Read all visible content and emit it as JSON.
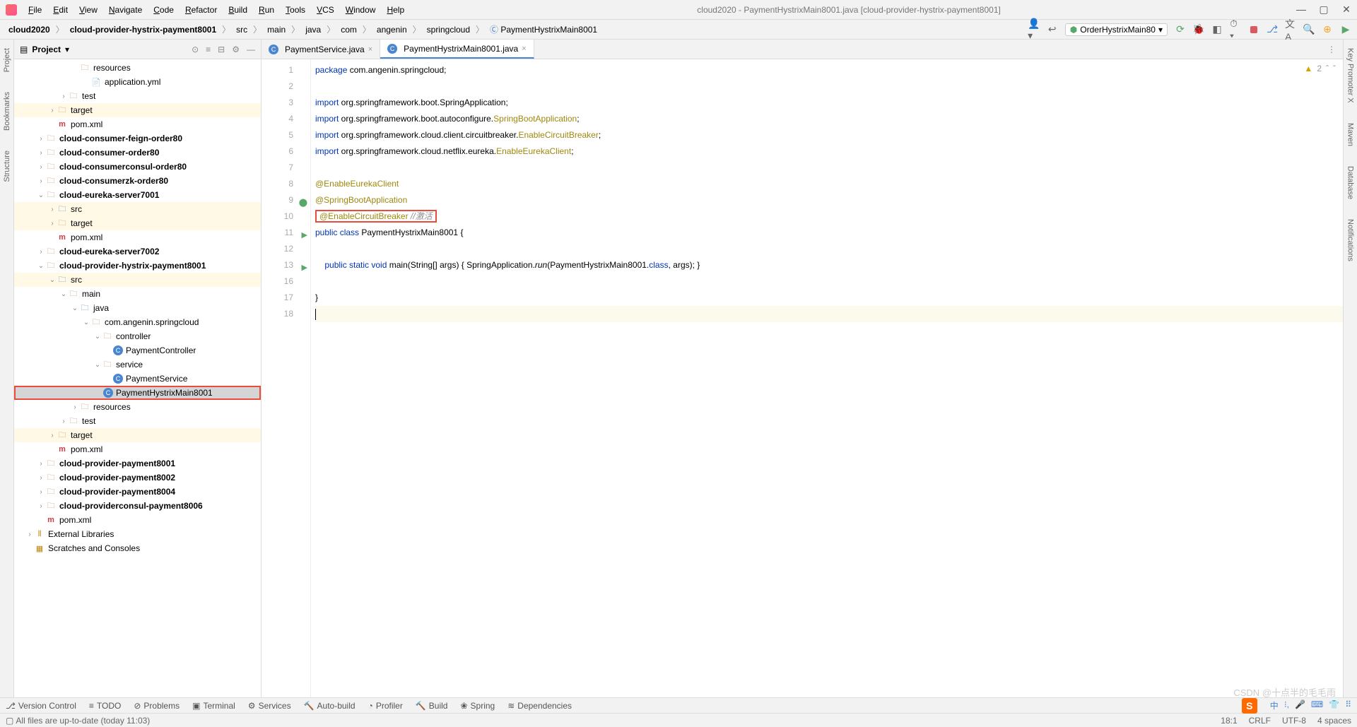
{
  "title": "cloud2020 - PaymentHystrixMain8001.java [cloud-provider-hystrix-payment8001]",
  "menu": [
    "File",
    "Edit",
    "View",
    "Navigate",
    "Code",
    "Refactor",
    "Build",
    "Run",
    "Tools",
    "VCS",
    "Window",
    "Help"
  ],
  "breadcrumbs": [
    "cloud2020",
    "cloud-provider-hystrix-payment8001",
    "src",
    "main",
    "java",
    "com",
    "angenin",
    "springcloud",
    "PaymentHystrixMain8001"
  ],
  "runConfig": "OrderHystrixMain80",
  "projectHeader": "Project",
  "tree": [
    {
      "d": 5,
      "a": "",
      "i": "folder",
      "t": "resources"
    },
    {
      "d": 6,
      "a": "",
      "i": "file",
      "t": "application.yml"
    },
    {
      "d": 4,
      "a": ">",
      "i": "folder",
      "t": "test"
    },
    {
      "d": 3,
      "a": ">",
      "i": "folder-target",
      "t": "target",
      "hl": true
    },
    {
      "d": 3,
      "a": "",
      "i": "file-m",
      "t": "pom.xml"
    },
    {
      "d": 2,
      "a": ">",
      "i": "folder",
      "t": "cloud-consumer-feign-order80",
      "b": true
    },
    {
      "d": 2,
      "a": ">",
      "i": "folder",
      "t": "cloud-consumer-order80",
      "b": true
    },
    {
      "d": 2,
      "a": ">",
      "i": "folder",
      "t": "cloud-consumerconsul-order80",
      "b": true
    },
    {
      "d": 2,
      "a": ">",
      "i": "folder",
      "t": "cloud-consumerzk-order80",
      "b": true
    },
    {
      "d": 2,
      "a": "v",
      "i": "folder",
      "t": "cloud-eureka-server7001",
      "b": true
    },
    {
      "d": 3,
      "a": ">",
      "i": "folder-src",
      "t": "src",
      "hl": true
    },
    {
      "d": 3,
      "a": ">",
      "i": "folder-target",
      "t": "target",
      "hl": true
    },
    {
      "d": 3,
      "a": "",
      "i": "file-m",
      "t": "pom.xml"
    },
    {
      "d": 2,
      "a": ">",
      "i": "folder",
      "t": "cloud-eureka-server7002",
      "b": true
    },
    {
      "d": 2,
      "a": "v",
      "i": "folder",
      "t": "cloud-provider-hystrix-payment8001",
      "b": true
    },
    {
      "d": 3,
      "a": "v",
      "i": "folder-src",
      "t": "src",
      "hl": true
    },
    {
      "d": 4,
      "a": "v",
      "i": "folder",
      "t": "main"
    },
    {
      "d": 5,
      "a": "v",
      "i": "folder-src",
      "t": "java"
    },
    {
      "d": 6,
      "a": "v",
      "i": "folder",
      "t": "com.angenin.springcloud"
    },
    {
      "d": 7,
      "a": "v",
      "i": "folder",
      "t": "controller"
    },
    {
      "d": 8,
      "a": "",
      "i": "file-c",
      "t": "PaymentController"
    },
    {
      "d": 7,
      "a": "v",
      "i": "folder",
      "t": "service"
    },
    {
      "d": 8,
      "a": "",
      "i": "file-c",
      "t": "PaymentService"
    },
    {
      "d": 7,
      "a": "",
      "i": "file-c",
      "t": "PaymentHystrixMain8001",
      "sel": true,
      "box": true
    },
    {
      "d": 5,
      "a": ">",
      "i": "folder",
      "t": "resources"
    },
    {
      "d": 4,
      "a": ">",
      "i": "folder",
      "t": "test"
    },
    {
      "d": 3,
      "a": ">",
      "i": "folder-target",
      "t": "target",
      "hl": true
    },
    {
      "d": 3,
      "a": "",
      "i": "file-m",
      "t": "pom.xml"
    },
    {
      "d": 2,
      "a": ">",
      "i": "folder",
      "t": "cloud-provider-payment8001",
      "b": true
    },
    {
      "d": 2,
      "a": ">",
      "i": "folder",
      "t": "cloud-provider-payment8002",
      "b": true
    },
    {
      "d": 2,
      "a": ">",
      "i": "folder",
      "t": "cloud-provider-payment8004",
      "b": true
    },
    {
      "d": 2,
      "a": ">",
      "i": "folder",
      "t": "cloud-providerconsul-payment8006",
      "b": true
    },
    {
      "d": 2,
      "a": "",
      "i": "file-m",
      "t": "pom.xml"
    },
    {
      "d": 1,
      "a": ">",
      "i": "lib",
      "t": "External Libraries"
    },
    {
      "d": 1,
      "a": "",
      "i": "scratch",
      "t": "Scratches and Consoles"
    }
  ],
  "tabs": [
    {
      "label": "PaymentService.java",
      "active": false,
      "icon": "C"
    },
    {
      "label": "PaymentHystrixMain8001.java",
      "active": true,
      "icon": "C"
    }
  ],
  "warnings": "2",
  "code_lines": [
    "1",
    "2",
    "3",
    "4",
    "5",
    "6",
    "7",
    "8",
    "9",
    "10",
    "11",
    "12",
    "13",
    "16",
    "17",
    "18"
  ],
  "code": {
    "pkg_kw": "package",
    "pkg": " com.angenin.springcloud;",
    "imp_kw": "import",
    "imp1": " org.springframework.boot.SpringApplication;",
    "imp2a": " org.springframework.boot.autoconfigure.",
    "imp2b": "SpringBootApplication",
    "imp2c": ";",
    "imp3a": " org.springframework.cloud.client.circuitbreaker.",
    "imp3b": "EnableCircuitBreaker",
    "imp3c": ";",
    "imp4a": " org.springframework.cloud.netflix.eureka.",
    "imp4b": "EnableEurekaClient",
    "imp4c": ";",
    "ann1": "@EnableEurekaClient",
    "ann2": "@SpringBootApplication",
    "ann3": "@EnableCircuitBreaker",
    "ann3c": " //激活",
    "cls_kw1": "public ",
    "cls_kw2": "class ",
    "cls_name": "PaymentHystrixMain8001",
    " cls_brace": " {",
    "m_pub": "public ",
    "m_stat": "static ",
    "m_void": "void ",
    "m_main": "main",
    "m_args": "(String[] args)",
    "m_brace": " { ",
    "m_body1": "SpringApplication.",
    "m_run": "run",
    "m_body2": "(PaymentHystrixMain8001.",
    "m_class": "class",
    "m_body3": ", args); }",
    "end": "}"
  },
  "tools": [
    "Version Control",
    "TODO",
    "Problems",
    "Terminal",
    "Services",
    "Auto-build",
    "Profiler",
    "Build",
    "Spring",
    "Dependencies"
  ],
  "status_msg": "All files are up-to-date (today 11:03)",
  "status_right": [
    "18:1",
    "CRLF",
    "UTF-8",
    "4 spaces"
  ],
  "watermark": "CSDN @十点半的毛毛雨",
  "left_stripes": [
    "Project",
    "Bookmarks",
    "Structure"
  ],
  "right_stripes": [
    "Key Promoter X",
    "Maven",
    "Database",
    "Notifications"
  ]
}
